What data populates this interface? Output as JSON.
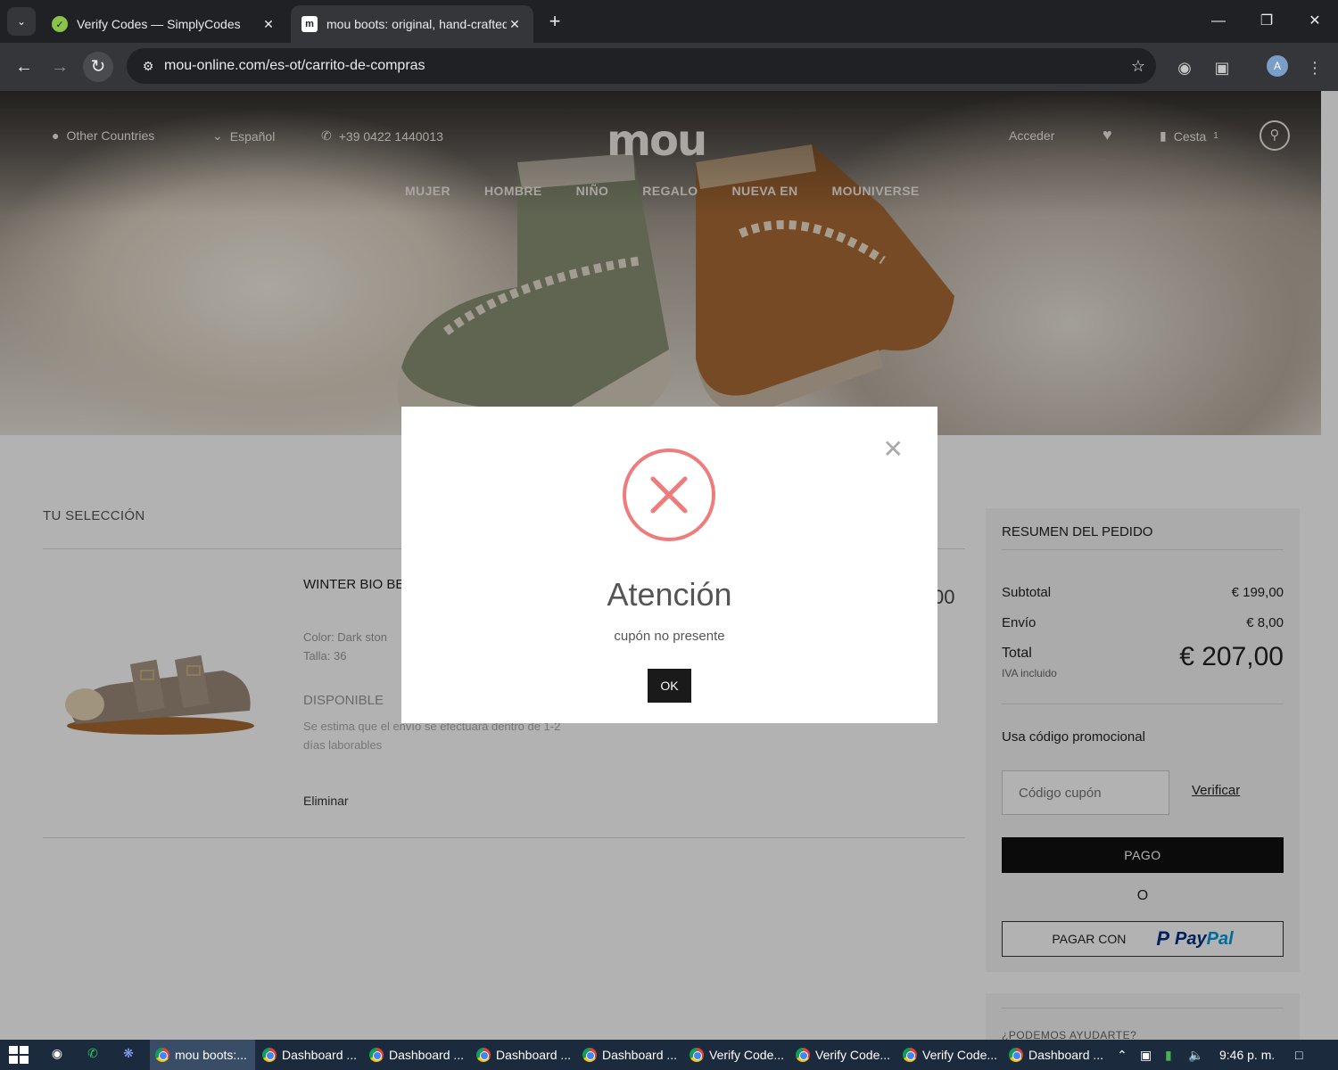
{
  "browser": {
    "tabs": [
      {
        "title": "Verify Codes — SimplyCodes",
        "active": false
      },
      {
        "title": "mou boots: original, hand-crafted",
        "active": true
      }
    ],
    "url": "mou-online.com/es-ot/carrito-de-compras",
    "profile_initial": "A"
  },
  "site": {
    "topbar": {
      "country": "Other Countries",
      "language": "Español",
      "phone": "+39 0422 1440013",
      "login": "Acceder",
      "cart": "Cesta",
      "cart_count": "1"
    },
    "logo": "mou",
    "menu": [
      "MUJER",
      "HOMBRE",
      "NIÑO",
      "REGALO",
      "NUEVA EN",
      "MOUNIVERSE"
    ]
  },
  "cart": {
    "section_title": "TU SELECCIÓN",
    "product": {
      "name": "WINTER BIO BE",
      "color": "Color: Dark ston",
      "size": "Talla: 36",
      "status": "DISPONIBLE",
      "note": "Se estima que el envío se efectuará dentro de 1-2 días laborables",
      "remove": "Eliminar",
      "price_partial": "00"
    }
  },
  "summary": {
    "title": "RESUMEN DEL PEDIDO",
    "subtotal_label": "Subtotal",
    "subtotal_value": "€ 199,00",
    "shipping_label": "Envío",
    "shipping_value": "€ 8,00",
    "total_label": "Total",
    "total_note": "IVA incluido",
    "total_value": "€ 207,00",
    "promo_label": "Usa código promocional",
    "coupon_placeholder": "Código cupón",
    "verify_label": "Verificar",
    "pay_label": "PAGO",
    "or_label": "O",
    "paypal_label": "PAGAR CON",
    "paypal_word_1": "Pay",
    "paypal_word_2": "Pal",
    "help_title": "¿PODEMOS AYUDARTE?"
  },
  "modal": {
    "title": "Atención",
    "message": "cupón no presente",
    "ok_label": "OK",
    "error_color": "#ef7b7b"
  },
  "taskbar": {
    "apps": [
      {
        "label": "mou boots:...",
        "active": true
      },
      {
        "label": "Dashboard ...",
        "active": false
      },
      {
        "label": "Dashboard ...",
        "active": false
      },
      {
        "label": "Dashboard ...",
        "active": false
      },
      {
        "label": "Dashboard ...",
        "active": false
      },
      {
        "label": "Verify Code...",
        "active": false
      },
      {
        "label": "Verify Code...",
        "active": false
      },
      {
        "label": "Verify Code...",
        "active": false
      },
      {
        "label": "Dashboard ...",
        "active": false
      }
    ],
    "clock": "9:46 p. m."
  }
}
